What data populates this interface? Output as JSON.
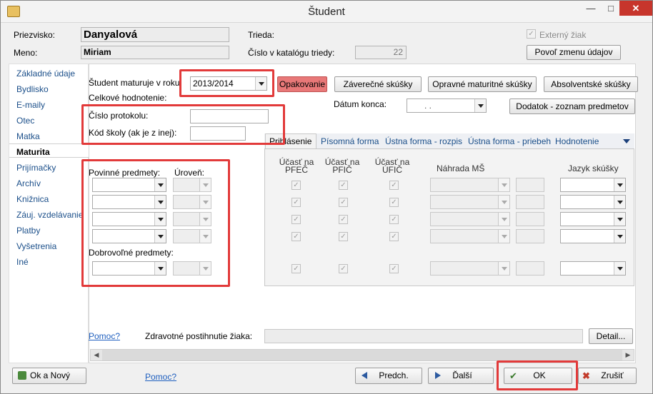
{
  "window": {
    "title": "Študent",
    "min": "—",
    "max": "□",
    "close": "✕"
  },
  "header": {
    "surname_label": "Priezvisko:",
    "surname_value": "Danyalová",
    "name_label": "Meno:",
    "name_value": "Miriam",
    "class_label": "Trieda:",
    "catalog_label": "Číslo v katalógu triedy:",
    "catalog_value": "22",
    "external_label": "Externý žiak",
    "external_checked": "✓",
    "allow_change_button": "Povoľ zmenu údajov"
  },
  "sidebar": {
    "items": [
      "Základné údaje",
      "Bydlisko",
      "E-maily",
      "Otec",
      "Matka",
      "Maturita",
      "Prijímačky",
      "Archív",
      "Knižnica",
      "Záuj. vzdelávanie",
      "Platby",
      "Vyšetrenia",
      "Iné"
    ],
    "selected": "Maturita"
  },
  "maturita": {
    "year_label": "Študent maturuje v roku:",
    "year_value": "2013/2014",
    "overall_label": "Celkové hodnotenie:",
    "protocol_label": "Číslo protokolu:",
    "school_label": "Kód školy (ak je z inej):",
    "repeat_button": "Opakovanie",
    "final_exams_button": "Záverečné skúšky",
    "correction_button": "Opravné maturitné skúšky",
    "graduate_button": "Absolventské skúšky",
    "end_date_label": "Dátum konca:",
    "end_date_value": ". .",
    "supplement_button": "Dodatok - zoznam predmetov",
    "mandatory_label": "Povinné predmety:",
    "level_label": "Úroveň:",
    "voluntary_label": "Dobrovoľné predmety:",
    "tabs": [
      "Prihlásenie",
      "Písomná forma",
      "Ústna forma - rozpis",
      "Ústna forma - priebeh",
      "Hodnotenie"
    ],
    "active_tab": "Prihlásenie",
    "col_pfec": "Účasť na PFEČ",
    "col_pfic": "Účasť na PFIČ",
    "col_ufic": "Účasť na ÚFIČ",
    "col_nahrada": "Náhrada MŠ",
    "col_jazyk": "Jazyk skúšky",
    "check_mark": "✓",
    "help_link": "Pomoc?",
    "health_label": "Zdravotné postihnutie žiaka:",
    "detail_button": "Detail..."
  },
  "footer": {
    "ok_new_button": "Ok a Nový",
    "help_link": "Pomoc?",
    "prev_button": "Predch.",
    "next_button": "Ďalší",
    "ok_button": "OK",
    "cancel_button": "Zrušiť"
  }
}
